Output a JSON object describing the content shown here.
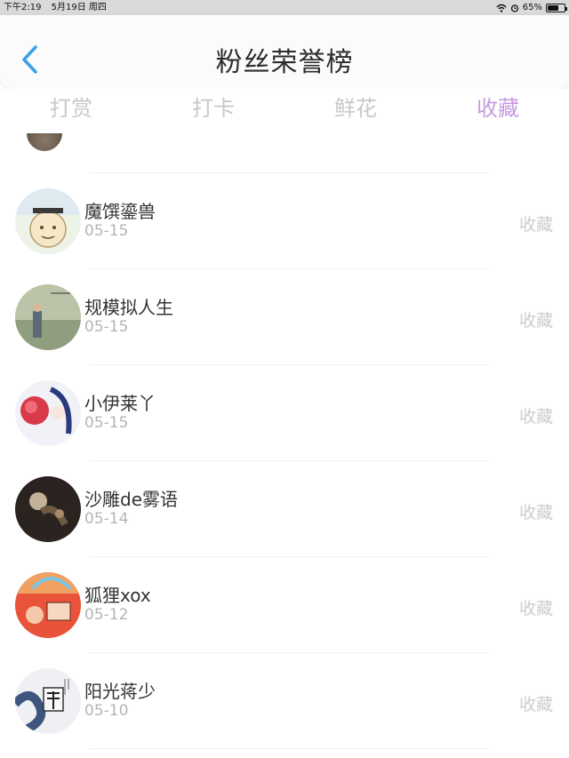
{
  "status": {
    "time": "下午2:19",
    "date": "5月19日 周四",
    "battery": "65%",
    "battery_level": 0.65
  },
  "nav": {
    "title": "粉丝荣誉榜"
  },
  "tabs": [
    {
      "label": "打赏",
      "active": false
    },
    {
      "label": "打卡",
      "active": false
    },
    {
      "label": "鲜花",
      "active": false
    },
    {
      "label": "收藏",
      "active": true
    }
  ],
  "colors": {
    "accent": "#c89ae0",
    "inactive_tab": "#c8c8c8",
    "nav_back": "#3aa0e8"
  },
  "fans": [
    {
      "name": "魔馔鎏兽",
      "date": "05-15",
      "action": "收藏"
    },
    {
      "name": "规模拟人生",
      "date": "05-15",
      "action": "收藏"
    },
    {
      "name": "小伊莱丫",
      "date": "05-15",
      "action": "收藏"
    },
    {
      "name": "沙雕de雾语",
      "date": "05-14",
      "action": "收藏"
    },
    {
      "name": "狐狸xox",
      "date": "05-12",
      "action": "收藏"
    },
    {
      "name": "阳光蒋少",
      "date": "05-10",
      "action": "收藏"
    }
  ]
}
